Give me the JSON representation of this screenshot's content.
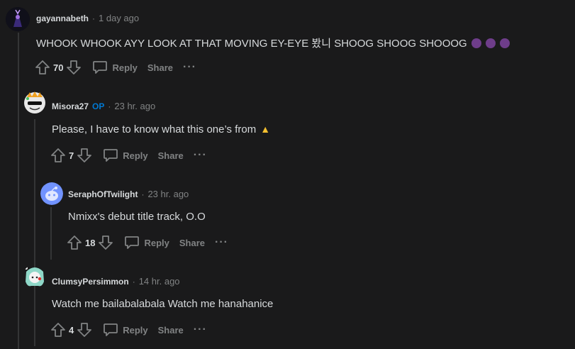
{
  "comments": [
    {
      "author": "gayannabeth",
      "op": "",
      "time": "1 day ago",
      "body": "WHOOK WHOOK AYY LOOK AT THAT MOVING EY-EYE 봤니 SHOOG SHOOG SHOOOG",
      "votes": "70",
      "reply": "Reply",
      "share": "Share",
      "more": "···"
    },
    {
      "author": "Misora27",
      "op": "OP",
      "time": "23 hr. ago",
      "body": "Please, I have to know what this one’s from",
      "votes": "7",
      "reply": "Reply",
      "share": "Share",
      "more": "···"
    },
    {
      "author": "SeraphOfTwilight",
      "op": "",
      "time": "23 hr. ago",
      "body": "Nmixx's debut title track, O.O",
      "votes": "18",
      "reply": "Reply",
      "share": "Share",
      "more": "···"
    },
    {
      "author": "ClumsyPersimmon",
      "op": "",
      "time": "14 hr. ago",
      "body": "Watch me bailabalabala Watch me hanahanice",
      "votes": "4",
      "reply": "Reply",
      "share": "Share",
      "more": "···"
    }
  ],
  "dot": "·"
}
